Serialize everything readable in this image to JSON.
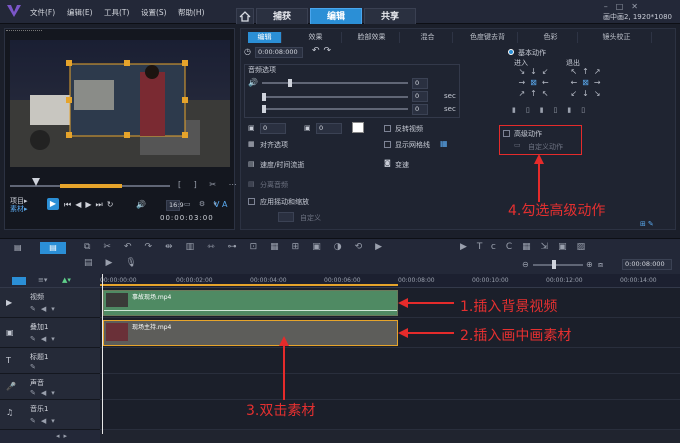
{
  "titlebar": {
    "menu": [
      "文件(F)",
      "编辑(E)",
      "工具(T)",
      "设置(S)",
      "帮助(H)"
    ],
    "tabs": [
      "捕获",
      "编辑",
      "共享"
    ],
    "resolution": "画中画2, 1920*1080"
  },
  "preview": {
    "mode_project": "项目▸",
    "mode_clip": "素材▸",
    "timecode": "00:00:03:00",
    "zoom": "16:9"
  },
  "editor": {
    "subtabs": [
      "编辑",
      "效果",
      "脸部效果",
      "混合",
      "色度键去背",
      "色彩",
      "镜头校正"
    ],
    "duration": "0:00:08:000",
    "audio_label": "音频选项",
    "sec1": "sec",
    "sec2": "sec",
    "val_zero": "0",
    "flip_video": "反转视频",
    "align_options": "对齐选项",
    "show_gridlines": "显示网格线",
    "speed_time": "速度/时间流逝",
    "transition": "变速",
    "split_audio": "分离音频",
    "apply_pan_zoom": "应用摇动和缩放",
    "custom": "自定义",
    "basic_motion": "基本动作",
    "enter": "进入",
    "exit": "退出",
    "advanced_motion": "高级动作",
    "custom_motion": "自定义动作"
  },
  "annotations": {
    "step1": "1.插入背景视频",
    "step2": "2.插入画中画素材",
    "step3": "3.双击素材",
    "step4": "4.勾选高级动作"
  },
  "timeline": {
    "timecode": "0:00:08:000",
    "ruler": [
      "00:00:00:00",
      "00:00:02:00",
      "00:00:04:00",
      "00:00:06:00",
      "00:00:08:00",
      "00:00:10:00",
      "00:00:12:00",
      "00:00:14:00"
    ],
    "tracks": [
      "视频",
      "叠加1",
      "标题1",
      "声音",
      "音乐1"
    ],
    "clip_video": "事故现场.mp4",
    "clip_overlay": "现场主持.mp4"
  },
  "colors": {
    "accent": "#2b8fd6",
    "annotation_red": "#e52b2b",
    "video_clip": "#4f8a63",
    "overlay_clip": "#5d5d5a",
    "clip_border_selected": "#e6a42b"
  }
}
